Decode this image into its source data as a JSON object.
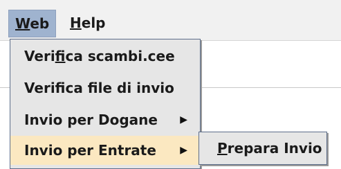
{
  "menubar": {
    "web": {
      "mnemonic": "W",
      "rest": "eb"
    },
    "help": {
      "mnemonic": "H",
      "rest": "elp"
    }
  },
  "web_menu": {
    "items": [
      {
        "label_pre": "Veri",
        "label_mn": "f",
        "label_post": "ica scambi.cee",
        "has_submenu": false
      },
      {
        "label": "Verifica file di invio",
        "has_submenu": false
      },
      {
        "label": "Invio per Dogane",
        "has_submenu": true,
        "arrow": "▶"
      },
      {
        "label": "Invio per Entrate",
        "has_submenu": true,
        "arrow": "▶",
        "selected": true
      }
    ]
  },
  "submenu": {
    "items": [
      {
        "mnemonic": "P",
        "rest": "repara Invio"
      }
    ]
  },
  "colors": {
    "selected_bg": "#fbe8c1",
    "menubar_active": "#9fb3cf",
    "menu_bg": "#e6e6e6"
  }
}
